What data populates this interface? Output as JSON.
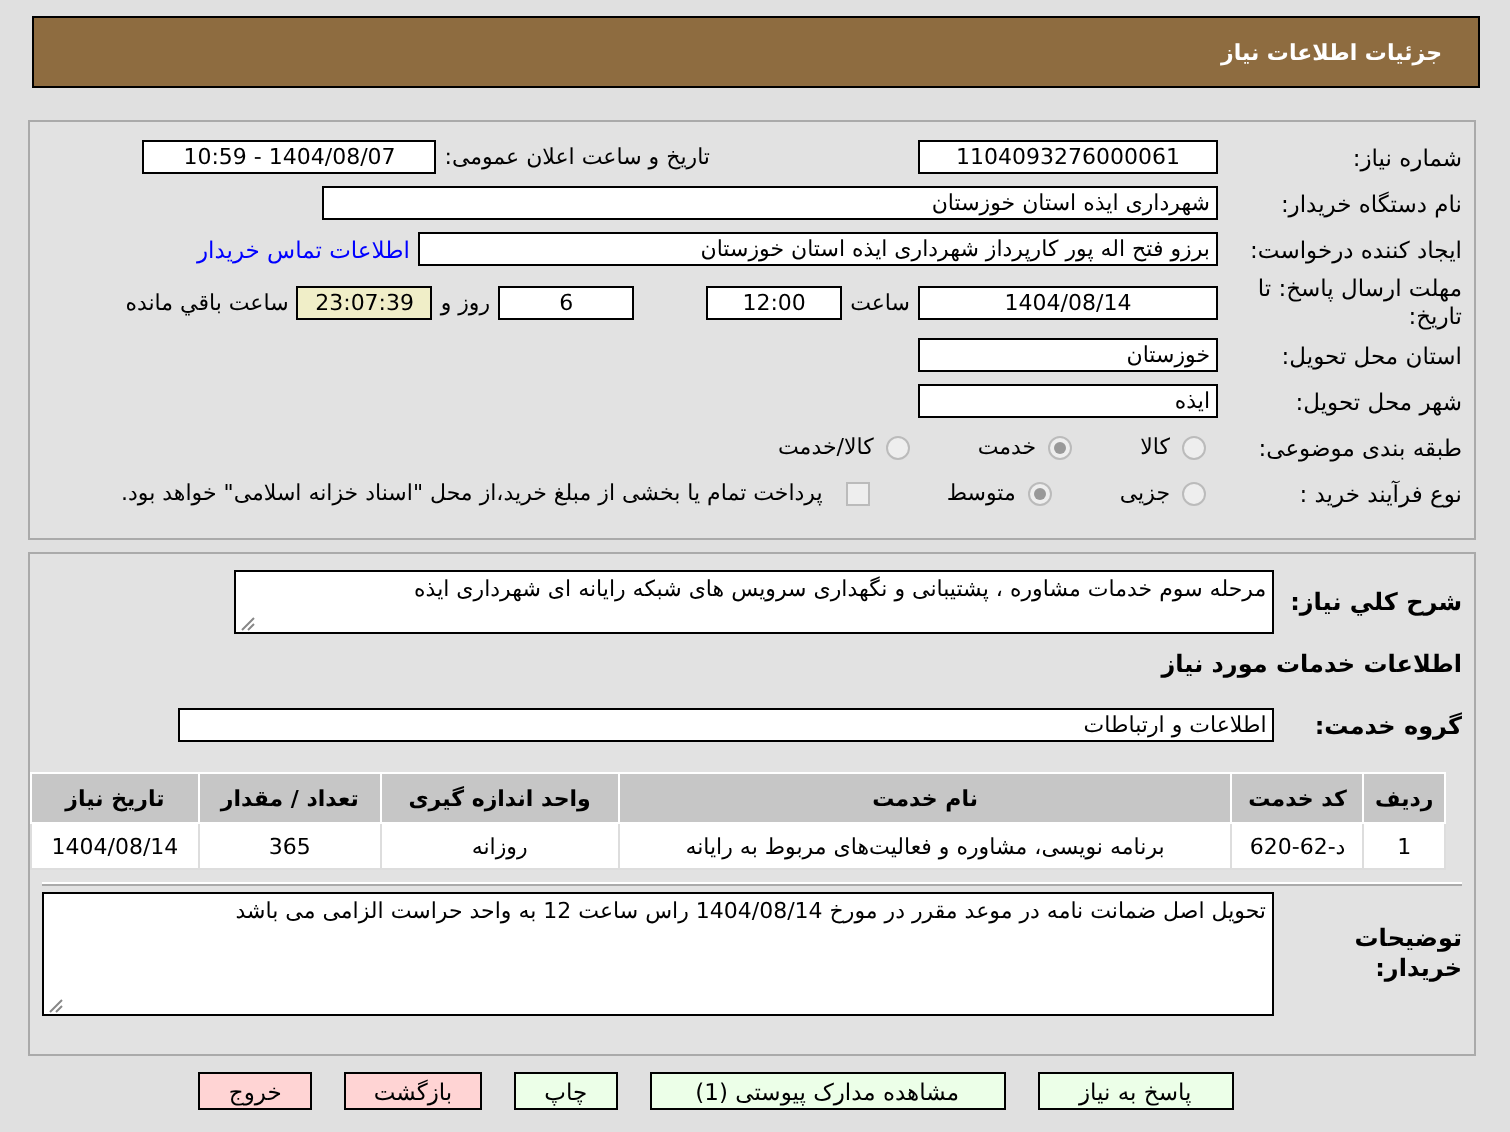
{
  "header": {
    "title": "جزئیات اطلاعات نیاز"
  },
  "need_number": {
    "label": "شماره نیاز:",
    "value": "1104093276000061"
  },
  "announce": {
    "label": "تاریخ و ساعت اعلان عمومی:",
    "value": "1404/08/07 - 10:59"
  },
  "buyer_org": {
    "label": "نام دستگاه خریدار:",
    "value": "شهرداری ایذه استان خوزستان"
  },
  "requester": {
    "label": "ایجاد کننده درخواست:",
    "value": "برزو فتح اله پور کارپرداز شهرداری ایذه استان خوزستان",
    "link": "اطلاعات تماس خریدار"
  },
  "deadline": {
    "label": "مهلت ارسال پاسخ: تا تاریخ:",
    "date": "1404/08/14",
    "time_label": "ساعت",
    "time": "12:00",
    "days": "6",
    "days_label": "روز و",
    "remaining": "23:07:39",
    "remaining_label": "ساعت باقي مانده"
  },
  "province": {
    "label": "استان محل تحویل:",
    "value": "خوزستان"
  },
  "city": {
    "label": "شهر محل تحویل:",
    "value": "ایذه"
  },
  "category": {
    "label": "طبقه بندی موضوعی:",
    "options": [
      {
        "label": "کالا",
        "selected": false
      },
      {
        "label": "خدمت",
        "selected": true
      },
      {
        "label": "کالا/خدمت",
        "selected": false
      }
    ]
  },
  "purchase_type": {
    "label": "نوع فرآیند خرید :",
    "options": [
      {
        "label": "جزیی",
        "selected": false
      },
      {
        "label": "متوسط",
        "selected": true
      }
    ],
    "payment": {
      "label": "پرداخت تمام یا بخشی از مبلغ خرید،از محل \"اسناد خزانه اسلامی\" خواهد بود.",
      "checked": false
    }
  },
  "description": {
    "label": "شرح کلي نياز:",
    "value": "مرحله سوم خدمات مشاوره ، پشتیبانی و نگهداری سرویس های شبکه رایانه ای شهرداری ایذه"
  },
  "services_heading": "اطلاعات خدمات مورد نیاز",
  "service_group": {
    "label": "گروه خدمت:",
    "value": "اطلاعات و ارتباطات"
  },
  "table": {
    "columns": [
      "ردیف",
      "کد خدمت",
      "نام خدمت",
      "واحد اندازه گیری",
      "تعداد / مقدار",
      "تاریخ نیاز"
    ],
    "rows": [
      [
        "1",
        "د-62-620",
        "برنامه نویسی، مشاوره و فعالیت‌های مربوط به رایانه",
        "روزانه",
        "365",
        "1404/08/14"
      ]
    ]
  },
  "buyer_notes": {
    "label": "توضیحات خریدار:",
    "value": "تحویل اصل ضمانت نامه در موعد مقرر در مورخ 1404/08/14 راس ساعت 12 به واحد حراست الزامی می باشد"
  },
  "buttons": [
    {
      "label": "پاسخ به نیاز",
      "kind": "action"
    },
    {
      "label": "مشاهده مدارک پیوستی (1)",
      "kind": "action"
    },
    {
      "label": "چاپ",
      "kind": "action"
    },
    {
      "label": "بازگشت",
      "kind": "danger"
    },
    {
      "label": "خروج",
      "kind": "danger"
    }
  ]
}
